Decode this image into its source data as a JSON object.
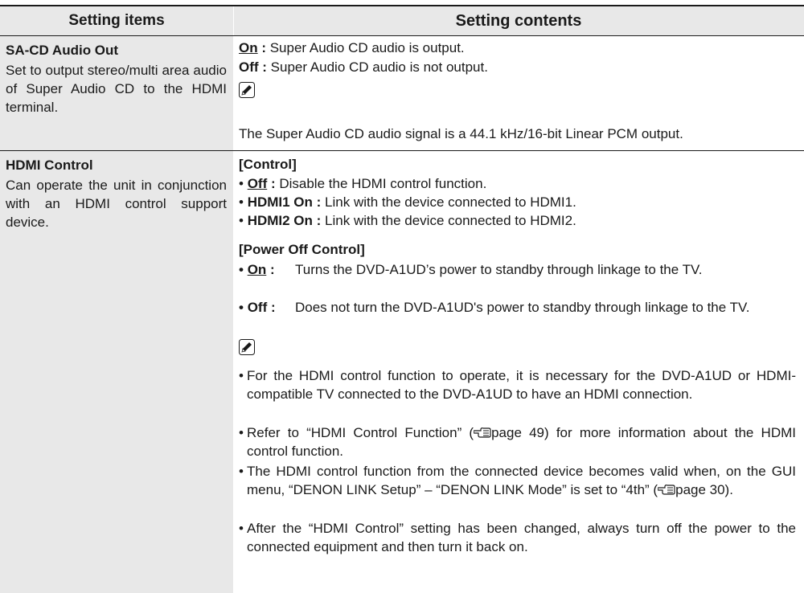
{
  "header": {
    "col1": "Setting items",
    "col2": "Setting contents"
  },
  "row1": {
    "title": "SA-CD Audio Out",
    "description": "Set to output stereo/multi area audio of  Super Audio CD to the HDMI  terminal.",
    "options": [
      {
        "label": "On",
        "sep": " :",
        "text": " Super Audio CD audio is output."
      },
      {
        "label": "Off",
        "sep": " :",
        "text": " Super Audio CD audio is not output."
      }
    ],
    "note": "The Super Audio CD audio signal is a 44.1 kHz/16-bit Linear PCM output."
  },
  "row2": {
    "title": "HDMI Control",
    "description": "Can operate the unit in conjunction with an HDMI control support device.",
    "control": {
      "heading": "[Control]",
      "items": [
        {
          "label": "Off",
          "sep": " :",
          "text": " Disable the HDMI control function."
        },
        {
          "label": "HDMI1 On",
          "sep": " :",
          "text": " Link with the device connected to HDMI1."
        },
        {
          "label": "HDMI2 On",
          "sep": " :",
          "text": " Link with the device connected to HDMI2."
        }
      ]
    },
    "power_off": {
      "heading": "[Power Off Control]",
      "items": [
        {
          "label": "On",
          "sep": " :",
          "text": "Turns the DVD-A1UD’s power to standby through linkage to the TV."
        },
        {
          "label": "Off",
          "sep": " :",
          "text": "Does not turn the DVD-A1UD's power to standby through linkage to the TV."
        }
      ]
    },
    "notes": [
      "For the HDMI control function to operate, it is necessary for the DVD-A1UD or HDMI-compatible TV connected to the DVD-A1UD  to have an HDMI connection.",
      "Refer to “HDMI Control Function” (",
      "page 49) for more information about the HDMI control function.",
      "The HDMI control function from the connected device becomes valid when, on the GUI menu, “DENON LINK Setup” – “DENON LINK Mode” is set to “4th” (",
      "page 30).",
      "After the “HDMI Control” setting has been changed, always turn off the power to the connected equipment and then turn it back on."
    ]
  },
  "icons": {
    "note": "pencil-icon",
    "page_ref": "pointing-hand-icon"
  }
}
